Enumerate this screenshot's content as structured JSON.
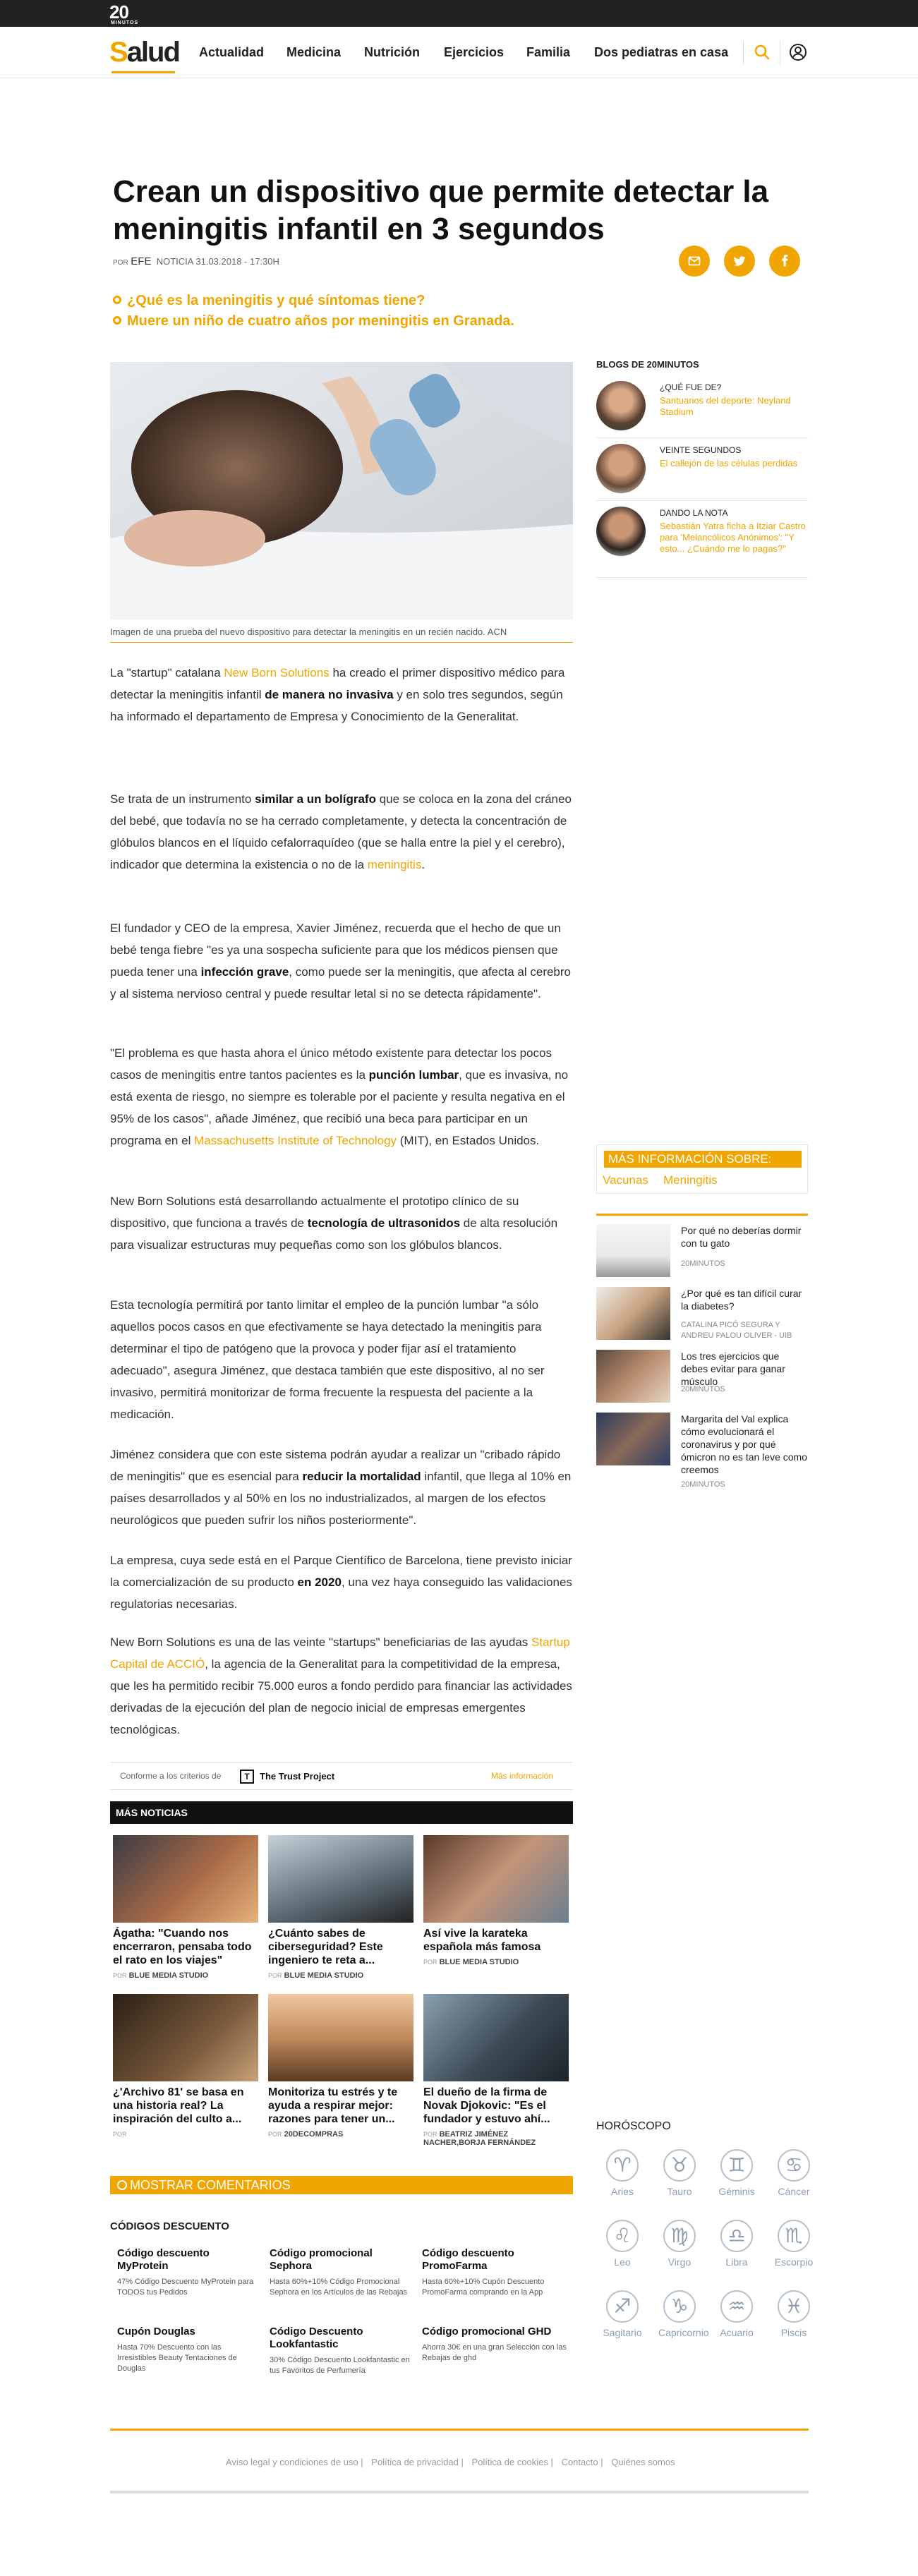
{
  "topbar": {
    "logo": "20",
    "logo_sub": "MINUTOS"
  },
  "brand": {
    "first": "S",
    "rest": "alud"
  },
  "nav": [
    "Actualidad",
    "Medicina",
    "Nutrición",
    "Ejercicios",
    "Familia",
    "Dos pediatras en casa"
  ],
  "article": {
    "title": "Crean un dispositivo que permite detectar la meningitis infantil en 3 segundos",
    "byline_por": "POR",
    "byline_author": "EFE",
    "byline_type": "NOTICIA",
    "byline_date": "31.03.2018 - 17:30H",
    "related": [
      "¿Qué es la meningitis y qué síntomas tiene?",
      "Muere un niño de cuatro años por meningitis en Granada."
    ],
    "caption": "Imagen de una prueba del nuevo dispositivo para detectar la meningitis en un recién nacido. ACN",
    "p1_a": "La \"startup\" catalana ",
    "p1_link": "New Born Solutions",
    "p1_b": " ha creado el primer dispositivo médico para detectar la meningitis infantil ",
    "p1_bold": "de manera no invasiva",
    "p1_c": " y en solo tres segundos, según ha informado el departamento de Empresa y Conocimiento de la Generalitat.",
    "p2_a": "Se trata de un instrumento ",
    "p2_bold": "similar a un bolígrafo",
    "p2_b": " que se coloca en la zona del cráneo del bebé, que todavía no se ha cerrado completamente, y detecta la concentración de glóbulos blancos en el líquido cefalorraquídeo (que se halla entre la piel y el cerebro), indicador que determina la existencia o no de la ",
    "p2_link": "meningitis",
    "p2_c": ".",
    "p3_a": "El fundador y CEO de la empresa, Xavier Jiménez, recuerda que el hecho de que un bebé tenga fiebre \"es ya una sospecha suficiente para que los médicos piensen que pueda tener una ",
    "p3_bold": "infección grave",
    "p3_b": ", como puede ser la meningitis, que afecta al cerebro y al sistema nervioso central y puede resultar letal si no se detecta rápidamente\".",
    "p4_a": "\"El problema es que hasta ahora el único método existente para detectar los pocos casos de meningitis entre tantos pacientes es la ",
    "p4_bold": "punción lumbar",
    "p4_b": ", que es invasiva, no está exenta de riesgo, no siempre es tolerable por el paciente y resulta negativa en el 95% de los casos\", añade Jiménez, que recibió una beca para participar en un programa en el ",
    "p4_link": "Massachusetts Institute of Technology",
    "p4_c": " (MIT), en Estados Unidos.",
    "p5_a": "New Born Solutions está desarrollando actualmente el prototipo clínico de su dispositivo, que funciona a través de ",
    "p5_bold": "tecnología de ultrasonidos",
    "p5_b": " de alta resolución para visualizar estructuras muy pequeñas como son los glóbulos blancos.",
    "p6": "Esta tecnología permitirá por tanto limitar el empleo de la punción lumbar \"a sólo aquellos pocos casos en que efectivamente se haya detectado la meningitis para determinar el tipo de patógeno que la provoca y poder fijar así el tratamiento adecuado\", asegura Jiménez, que destaca también que este dispositivo, al no ser invasivo, permitirá monitorizar de forma frecuente la respuesta del paciente a la medicación.",
    "p7_a": "Jiménez considera que con este sistema podrán ayudar a realizar un \"cribado rápido de meningitis\" que es esencial para ",
    "p7_bold": "reducir la mortalidad",
    "p7_b": " infantil, que llega al 10% en países desarrollados y al 50% en los no industrializados, al margen de los efectos neurológicos que pueden sufrir los niños posteriormente\".",
    "p8_a": "La empresa, cuya sede está en el Parque Científico de Barcelona, tiene previsto iniciar la comercialización de su producto ",
    "p8_bold": "en 2020",
    "p8_b": ", una vez haya conseguido las validaciones regulatorias necesarias.",
    "p9_a": "New Born Solutions es una de las veinte \"startups\" beneficiarias de las ayudas ",
    "p9_link": "Startup Capital de ACCIÓ",
    "p9_b": ", la agencia de la Generalitat para la competitividad de la empresa, que les ha permitido recibir 75.000 euros a fondo perdido para financiar las actividades derivadas de la ejecución del plan de negocio inicial de empresas emergentes tecnológicas."
  },
  "trust": {
    "text": "Conforme a los criterios de",
    "brand": "The Trust Project",
    "more": "Más información"
  },
  "blogs": {
    "title": "BLOGS DE 20MINUTOS",
    "items": [
      {
        "kicker": "¿QUÉ FUE DE?",
        "title": "Santuarios del deporte: Neyland Stadium"
      },
      {
        "kicker": "VEINTE SEGUNDOS",
        "title": "El callejón de las células perdidas"
      },
      {
        "kicker": "DANDO LA NOTA",
        "title": "Sebastián Yatra ficha a Itziar Castro para 'Melancólicos Anónimos': \"Y esto... ¿Cuándo me lo pagas?\""
      }
    ]
  },
  "masinfo": {
    "title": "MÁS INFORMACIÓN SOBRE:",
    "tags": [
      "Vacunas",
      "Meningitis"
    ]
  },
  "side_news": [
    {
      "title": "Por qué no deberías dormir con tu gato",
      "author": "20MINUTOS"
    },
    {
      "title": "¿Por qué es tan difícil curar la diabetes?",
      "author": "CATALINA PICÓ SEGURA Y ANDREU PALOU OLIVER - UIB"
    },
    {
      "title": "Los tres ejercicios que debes evitar para ganar músculo",
      "author": "20MINUTOS"
    },
    {
      "title": "Margarita del Val explica cómo evolucionará el coronavirus y por qué ómicron no es tan leve como creemos",
      "author": "20MINUTOS"
    }
  ],
  "mas_noticias": {
    "title": "MÁS NOTICIAS",
    "items": [
      {
        "title": "Ágatha: \"Cuando nos encerraron, pensaba todo el rato en los viajes\"",
        "por": "POR",
        "by": "BLUE MEDIA STUDIO"
      },
      {
        "title": "¿Cuánto sabes de ciberseguridad? Este ingeniero te reta a...",
        "por": "POR",
        "by": "BLUE MEDIA STUDIO"
      },
      {
        "title": "Así vive la karateka española más famosa",
        "por": "POR",
        "by": "BLUE MEDIA STUDIO"
      },
      {
        "title": "¿'Archivo 81' se basa en una historia real? La inspiración del culto a...",
        "por": "POR",
        "by": ""
      },
      {
        "title": "Monitoriza tu estrés y te ayuda a respirar mejor: razones para tener un...",
        "por": "POR",
        "by": "20DECOMPRAS"
      },
      {
        "title": "El dueño de la firma de Novak Djokovic: \"Es el fundador y estuvo ahí...",
        "por": "POR",
        "by": "BEATRIZ JIMÉNEZ NACHER,BORJA FERNÁNDEZ"
      }
    ]
  },
  "comments": {
    "label": "MOSTRAR COMENTARIOS"
  },
  "codigos": {
    "title": "CÓDIGOS DESCUENTO",
    "items": [
      {
        "h": "Código descuento MyProtein",
        "d": "47% Código Descuento MyProtein para TODOS tus Pedidos"
      },
      {
        "h": "Código promocional Sephora",
        "d": "Hasta 60%+10% Código Promocional Sephora en los Artículos de las Rebajas"
      },
      {
        "h": "Código descuento PromoFarma",
        "d": "Hasta 60%+10% Cupón Descuento PromoFarma comprando en la App"
      },
      {
        "h": "Cupón Douglas",
        "d": "Hasta 70% Descuento con las Irresistibles Beauty Tentaciones de Douglas"
      },
      {
        "h": "Código Descuento Lookfantastic",
        "d": "30% Código Descuento Lookfantastic en tus Favoritos de Perfumería"
      },
      {
        "h": "Código promocional GHD",
        "d": "Ahorra 30€ en una gran Selección con las Rebajas de ghd"
      }
    ]
  },
  "horoscopo": {
    "title": "HORÓSCOPO",
    "signs": [
      {
        "g": "♈",
        "n": "Aries"
      },
      {
        "g": "♉",
        "n": "Tauro"
      },
      {
        "g": "♊",
        "n": "Géminis"
      },
      {
        "g": "♋",
        "n": "Cáncer"
      },
      {
        "g": "♌",
        "n": "Leo"
      },
      {
        "g": "♍",
        "n": "Virgo"
      },
      {
        "g": "♎",
        "n": "Libra"
      },
      {
        "g": "♏",
        "n": "Escorpio"
      },
      {
        "g": "♐",
        "n": "Sagitario"
      },
      {
        "g": "♑",
        "n": "Capricornio"
      },
      {
        "g": "♒",
        "n": "Acuario"
      },
      {
        "g": "♓",
        "n": "Piscis"
      }
    ]
  },
  "footer": [
    "Aviso legal y condiciones de uso",
    "Política de privacidad",
    "Política de cookies",
    "Contacto",
    "Quiénes somos"
  ],
  "colors": {
    "accent": "#f0a500",
    "topbar": "#222222"
  }
}
